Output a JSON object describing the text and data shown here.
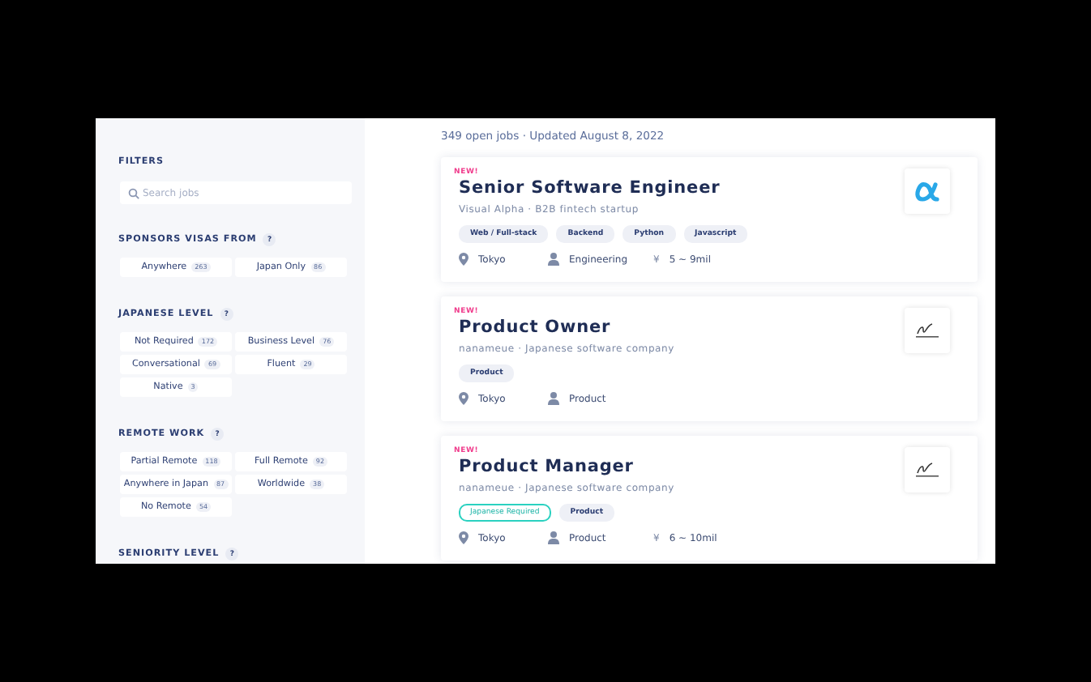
{
  "sidebar": {
    "title": "FILTERS",
    "search": {
      "placeholder": "Search jobs"
    },
    "sections": [
      {
        "title": "SPONSORS VISAS FROM",
        "help": "?",
        "options": [
          {
            "label": "Anywhere",
            "count": "263"
          },
          {
            "label": "Japan Only",
            "count": "86"
          }
        ]
      },
      {
        "title": "JAPANESE LEVEL",
        "help": "?",
        "options": [
          {
            "label": "Not Required",
            "count": "172"
          },
          {
            "label": "Business Level",
            "count": "76"
          },
          {
            "label": "Conversational",
            "count": "69"
          },
          {
            "label": "Fluent",
            "count": "29"
          },
          {
            "label": "Native",
            "count": "3"
          }
        ]
      },
      {
        "title": "REMOTE WORK",
        "help": "?",
        "options": [
          {
            "label": "Partial Remote",
            "count": "118"
          },
          {
            "label": "Full Remote",
            "count": "92"
          },
          {
            "label": "Anywhere in Japan",
            "count": "87"
          },
          {
            "label": "Worldwide",
            "count": "38"
          },
          {
            "label": "No Remote",
            "count": "54"
          }
        ]
      },
      {
        "title": "SENIORITY LEVEL",
        "help": "?"
      }
    ]
  },
  "summary": "349 open jobs · Updated August 8, 2022",
  "jobs": [
    {
      "badge": "NEW!",
      "title": "Senior Software Engineer",
      "company": "Visual Alpha · B2B fintech startup",
      "logo": {
        "kind": "alpha"
      },
      "tags": [
        {
          "label": "Web / Full-stack",
          "kind": "plain"
        },
        {
          "label": "Backend",
          "kind": "plain"
        },
        {
          "label": "Python",
          "kind": "plain"
        },
        {
          "label": "Javascript",
          "kind": "plain"
        }
      ],
      "location": "Tokyo",
      "team": "Engineering",
      "currency": "¥",
      "salary": "5 ~ 9mil"
    },
    {
      "badge": "NEW!",
      "title": "Product Owner",
      "company": "nanameue · Japanese software company",
      "logo": {
        "kind": "nanameue"
      },
      "tags": [
        {
          "label": "Product",
          "kind": "plain"
        }
      ],
      "location": "Tokyo",
      "team": "Product"
    },
    {
      "badge": "NEW!",
      "title": "Product Manager",
      "company": "nanameue · Japanese software company",
      "logo": {
        "kind": "nanameue"
      },
      "tags": [
        {
          "label": "Japanese Required",
          "kind": "highlight"
        },
        {
          "label": "Product",
          "kind": "plain"
        }
      ],
      "location": "Tokyo",
      "team": "Product",
      "currency": "¥",
      "salary": "6 ~ 10mil"
    }
  ]
}
